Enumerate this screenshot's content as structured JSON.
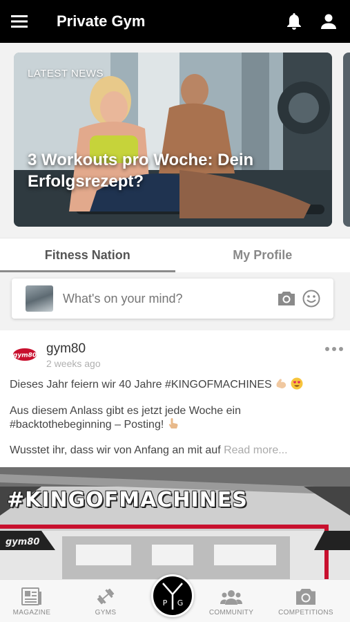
{
  "header": {
    "title": "Private Gym",
    "menu_icon": "hamburger-menu-icon",
    "notifications_icon": "bell-icon",
    "profile_icon": "user-icon"
  },
  "news": {
    "label": "LATEST NEWS",
    "headline": "3 Workouts pro Woche: Dein Erfolgsrezept?"
  },
  "tabs": [
    {
      "label": "Fitness Nation",
      "active": true
    },
    {
      "label": "My Profile",
      "active": false
    }
  ],
  "composer": {
    "placeholder": "What's on your mind?",
    "camera_icon": "camera-icon",
    "emoji_icon": "smiley-icon"
  },
  "post": {
    "logo_text": "gym80",
    "author": "gym80",
    "time": "2 weeks ago",
    "line1": "Dieses Jahr feiern wir 40 Jahre #KINGOFMACHINES",
    "line2": "Aus diesem Anlass gibt es jetzt jede Woche ein",
    "line3": "#backtothebeginning – Posting!",
    "line4": "Wusstet ihr, dass wir von Anfang an mit auf ",
    "read_more": "Read more...",
    "image_banner": "#KINGOFMACHINES",
    "image_logo": "gym80"
  },
  "bottom_nav": [
    {
      "label": "MAGAZINE",
      "icon": "newspaper-icon"
    },
    {
      "label": "GYMS",
      "icon": "dumbbell-icon"
    },
    {
      "label": "",
      "icon": "ypg-logo"
    },
    {
      "label": "COMMUNITY",
      "icon": "group-icon"
    },
    {
      "label": "COMPETITIONS",
      "icon": "camera-icon"
    }
  ],
  "colors": {
    "topbar": "#000000",
    "tab_indicator": "#8a8a8a",
    "nav_text": "#8a8a8a",
    "banner_red": "#c8102e"
  }
}
